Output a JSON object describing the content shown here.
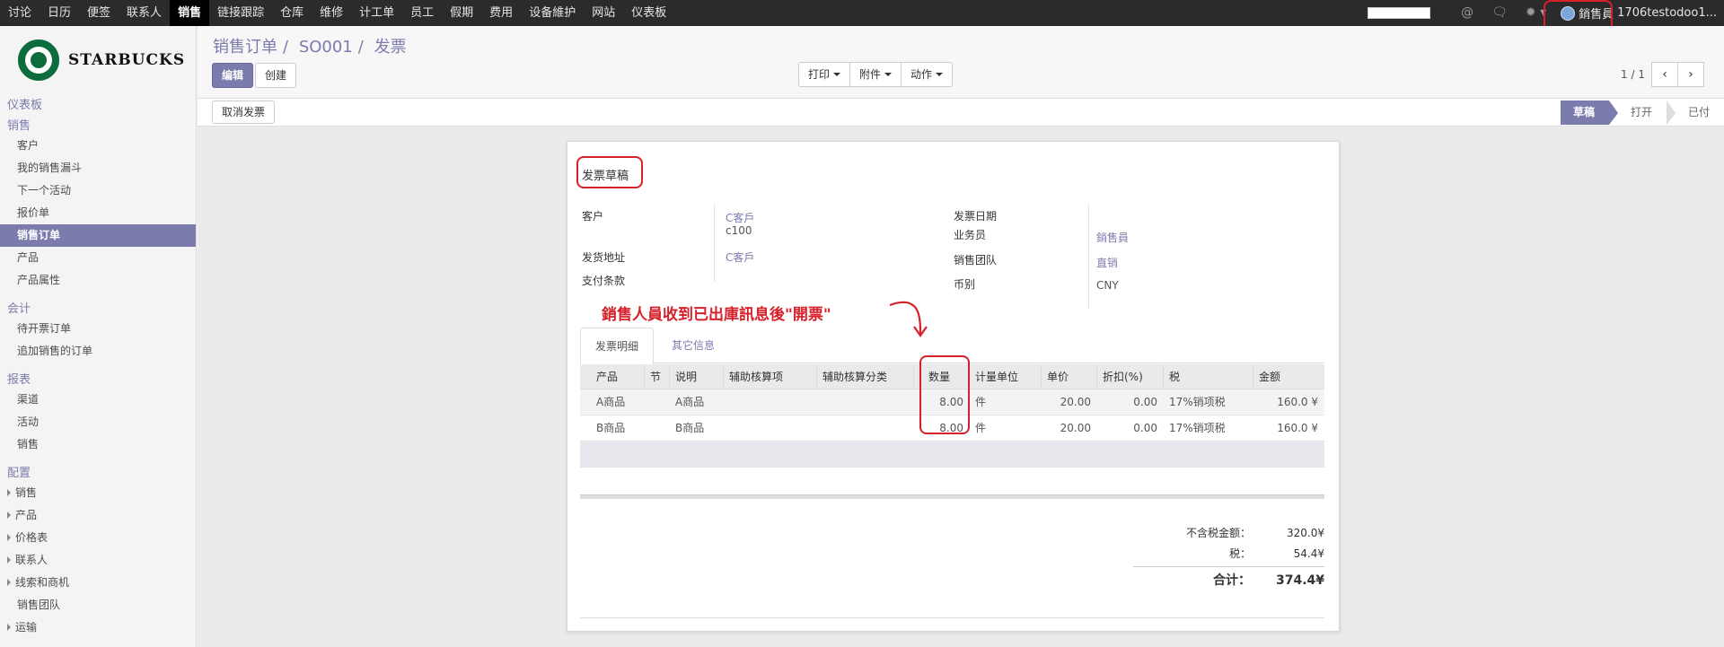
{
  "topnav": {
    "items": [
      "讨论",
      "日历",
      "便签",
      "联系人",
      "销售",
      "链接跟踪",
      "仓库",
      "维修",
      "计工单",
      "员工",
      "假期",
      "费用",
      "设备維护",
      "网站",
      "仪表板"
    ],
    "active_index": 4,
    "user": {
      "name": "銷售員",
      "database": "1706testodoo1..."
    },
    "icons": [
      "at-icon",
      "chat-icon",
      "bug-icon"
    ]
  },
  "brand": {
    "name": "STARBUCKS"
  },
  "sidebar": {
    "top_link": "仪表板",
    "sections": [
      {
        "title": "销售",
        "items": [
          "客户",
          "我的销售漏斗",
          "下一个活动",
          "报价单",
          "销售订单",
          "产品",
          "产品属性"
        ],
        "active": "销售订单"
      },
      {
        "title": "会计",
        "items": [
          "待开票订单",
          "追加销售的订单"
        ]
      },
      {
        "title": "报表",
        "items": [
          "渠道",
          "活动",
          "销售"
        ]
      },
      {
        "title": "配置",
        "items": [
          "销售",
          "产品",
          "价格表",
          "联系人",
          "线索和商机",
          "销售团队",
          "运输"
        ]
      }
    ]
  },
  "header": {
    "breadcrumb": [
      "销售订单",
      "SO001",
      "发票"
    ],
    "edit_label": "编辑",
    "create_label": "创建",
    "actions": [
      "打印",
      "附件",
      "动作"
    ],
    "pager": "1 / 1"
  },
  "statusbar": {
    "cancel_label": "取消发票",
    "states": [
      "草稿",
      "打开",
      "已付"
    ],
    "active_state": "草稿"
  },
  "invoice": {
    "title": "发票草稿",
    "customer_label": "客户",
    "customer_value": "C客戶",
    "customer_extra": "c100",
    "delivery_label": "发货地址",
    "delivery_value": "C客戶",
    "payment_label": "支付条款",
    "date_label": "发票日期",
    "salesperson_label": "业务员",
    "salesperson_value": "銷售員",
    "team_label": "销售团队",
    "team_value": "直销",
    "currency_label": "币别",
    "currency_value": "CNY",
    "annotation": "銷售人員收到已出庫訊息後\"開票\"",
    "tabs": [
      "发票明细",
      "其它信息"
    ],
    "columns": [
      "产品",
      "节",
      "说明",
      "辅助核算项",
      "辅助核算分类",
      "数量",
      "计量单位",
      "单价",
      "折扣(%)",
      "税",
      "金额"
    ],
    "lines": [
      {
        "product": "A商品",
        "section": "",
        "desc": "A商品",
        "aux_item": "",
        "aux_cat": "",
        "qty": "8.00",
        "uom": "件",
        "price": "20.00",
        "discount": "0.00",
        "tax": "17%销项税",
        "amount": "160.0 ¥"
      },
      {
        "product": "B商品",
        "section": "",
        "desc": "B商品",
        "aux_item": "",
        "aux_cat": "",
        "qty": "8.00",
        "uom": "件",
        "price": "20.00",
        "discount": "0.00",
        "tax": "17%销项税",
        "amount": "160.0 ¥"
      }
    ],
    "totals": {
      "untaxed_label": "不含税金额：",
      "untaxed_value": "320.0¥",
      "tax_label": "税：",
      "tax_value": "54.4¥",
      "total_label": "合计：",
      "total_value": "374.4¥"
    }
  },
  "colors": {
    "accent": "#7c7bad",
    "annotation_red": "#d7202a",
    "topbar": "#2b2b2b"
  }
}
